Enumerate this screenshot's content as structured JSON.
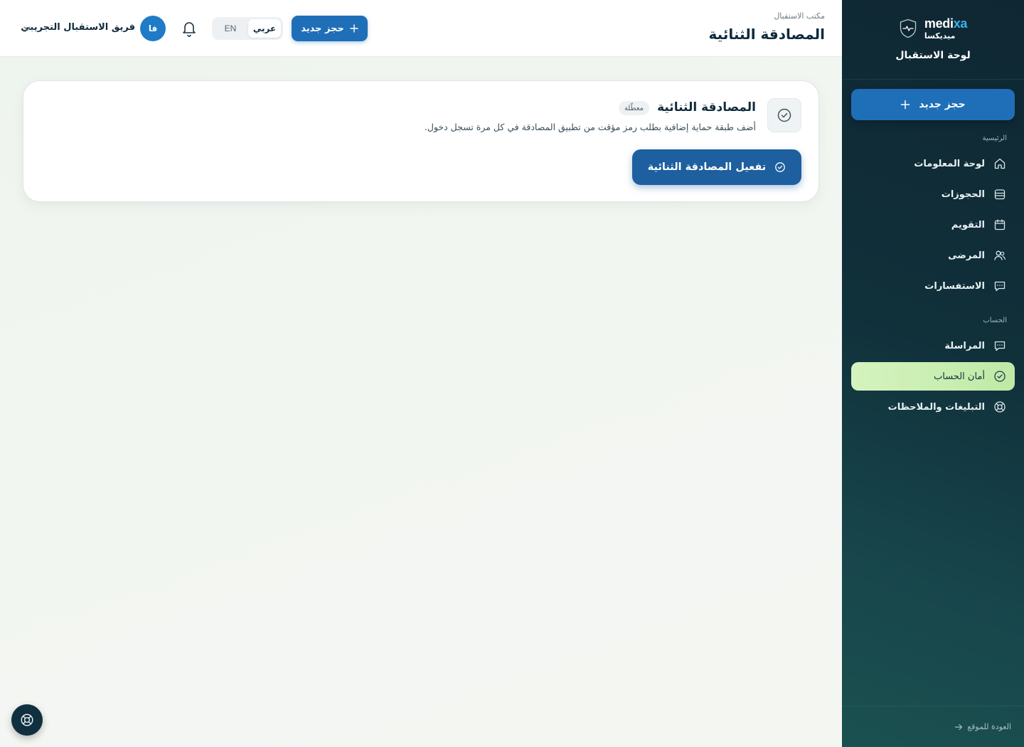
{
  "brand": {
    "name_latin_a": "medi",
    "name_latin_b": "xa",
    "name_ar": "ميديكسا",
    "subtitle": "لوحة الاستقبال"
  },
  "sidebar": {
    "new_booking": "حجز جديد",
    "section_main": "الرئيسية",
    "main_items": [
      {
        "label": "لوحة المعلومات",
        "icon": "home-icon"
      },
      {
        "label": "الحجوزات",
        "icon": "bookings-icon"
      },
      {
        "label": "التقويم",
        "icon": "calendar-icon"
      },
      {
        "label": "المرضى",
        "icon": "patients-icon"
      },
      {
        "label": "الاستفسارات",
        "icon": "chat-icon"
      }
    ],
    "section_account": "الحساب",
    "account_items": [
      {
        "label": "المراسلة",
        "icon": "chat-icon"
      },
      {
        "label": "أمان الحساب",
        "icon": "check-circle-icon",
        "active": true
      },
      {
        "label": "التبليغات والملاحظات",
        "icon": "lifebuoy-icon"
      }
    ],
    "back_to_site": "العودة للموقع"
  },
  "topbar": {
    "breadcrumb": "مكتب الاستقبال",
    "title": "المصادقة الثنائية",
    "new_booking": "حجز جديد",
    "lang_ar": "عربي",
    "lang_en": "EN",
    "avatar_initials": "فا",
    "user_name": "فريق الاستقبال التجريبي"
  },
  "card": {
    "title": "المصادقة الثنائية",
    "status_badge": "معطّلة",
    "description": "أضف طبقة حماية إضافية بطلب رمز مؤقت من تطبيق المصادقة في كل مرة تسجل دخول.",
    "action_label": "تفعيل المصادقة الثنائية"
  },
  "colors": {
    "primary": "#1f6fb8",
    "sidebar_bg": "#10303a",
    "active_item": "#c8eeb0",
    "text": "#0f2b3d"
  }
}
